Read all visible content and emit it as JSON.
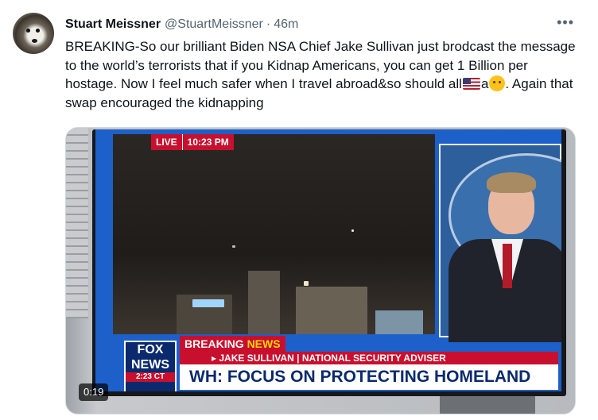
{
  "tweet": {
    "author_name": "Stuart Meissner",
    "handle": "@StuartMeissner",
    "separator": "·",
    "time": "46m",
    "more_icon": "more-horizontal-icon",
    "text_part1": "BREAKING-So our brilliant Biden NSA Chief Jake Sullivan just brodcast the message to the world’s terrorists that if you Kidnap Americans, you can get 1 Billion per hostage. Now I feel much safer when I travel abroad&so should all",
    "text_part2": "a",
    "text_part3": ". Again that swap encouraged the kidnapping",
    "emoji_flag": "us-flag-emoji",
    "emoji_face": "rolling-eyes-emoji"
  },
  "video": {
    "duration": "0:19",
    "tv_live": "LIVE",
    "tv_live_time": "10:23 PM",
    "tv_breaking_1": "BREAKING",
    "tv_breaking_2": "NEWS",
    "tv_subtitle": "▸ JAKE SULLIVAN | NATIONAL SECURITY ADVISER",
    "tv_headline": "WH: FOCUS ON PROTECTING HOMELAND",
    "tv_logo_line1": "FOX",
    "tv_logo_line2": "NEWS",
    "tv_clock": "2:23 CT"
  }
}
